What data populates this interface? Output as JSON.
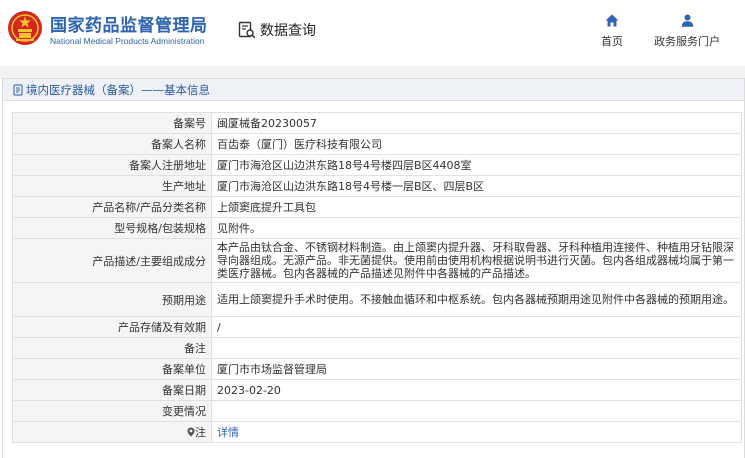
{
  "header": {
    "org_name_cn": "国家药品监督管理局",
    "org_name_en": "National Medical Products Administration",
    "query_label": "数据查询",
    "nav": {
      "home": "首页",
      "portal": "政务服务门户"
    }
  },
  "section": {
    "title": "境内医疗器械（备案）——基本信息"
  },
  "rows": [
    {
      "label": "备案号",
      "value": "闽厦械备20230057"
    },
    {
      "label": "备案人名称",
      "value": "百齿泰（厦门）医疗科技有限公司"
    },
    {
      "label": "备案人注册地址",
      "value": "厦门市海沧区山边洪东路18号4号楼四层B区4408室"
    },
    {
      "label": "生产地址",
      "value": "厦门市海沧区山边洪东路18号4号楼一层B区、四层B区"
    },
    {
      "label": "产品名称/产品分类名称",
      "value": "上颌窦底提升工具包"
    },
    {
      "label": "型号规格/包装规格",
      "value": "见附件。"
    },
    {
      "label": "产品描述/主要组成成分",
      "value": "本产品由钛合金、不锈钢材料制造。由上颌窦内提升器、牙科取骨器、牙科种植用连接件、种植用牙钻限深导向器组成。无源产品。非无菌提供。使用前由使用机构根据说明书进行灭菌。包内各组成器械均属于第一类医疗器械。包内各器械的产品描述见附件中各器械的产品描述。"
    },
    {
      "label": "预期用途",
      "value": "适用上颌窦提升手术时使用。不接触血循环和中枢系统。包内各器械预期用途见附件中各器械的预期用途。"
    },
    {
      "label": "产品存储及有效期",
      "value": "/"
    },
    {
      "label": "备注",
      "value": ""
    },
    {
      "label": "备案单位",
      "value": "厦门市市场监督管理局"
    },
    {
      "label": "备案日期",
      "value": "2023-02-20"
    },
    {
      "label": "变更情况",
      "value": ""
    },
    {
      "label": "注",
      "value": "详情"
    }
  ],
  "colors": {
    "brand_blue": "#2f64b0",
    "logo_red": "#d4261c",
    "logo_gold": "#f3c431"
  },
  "icons": {
    "logo": "national-emblem",
    "query": "document-search-icon",
    "home": "home-icon",
    "portal": "person-icon",
    "section": "document-icon",
    "note": "pin-icon"
  }
}
